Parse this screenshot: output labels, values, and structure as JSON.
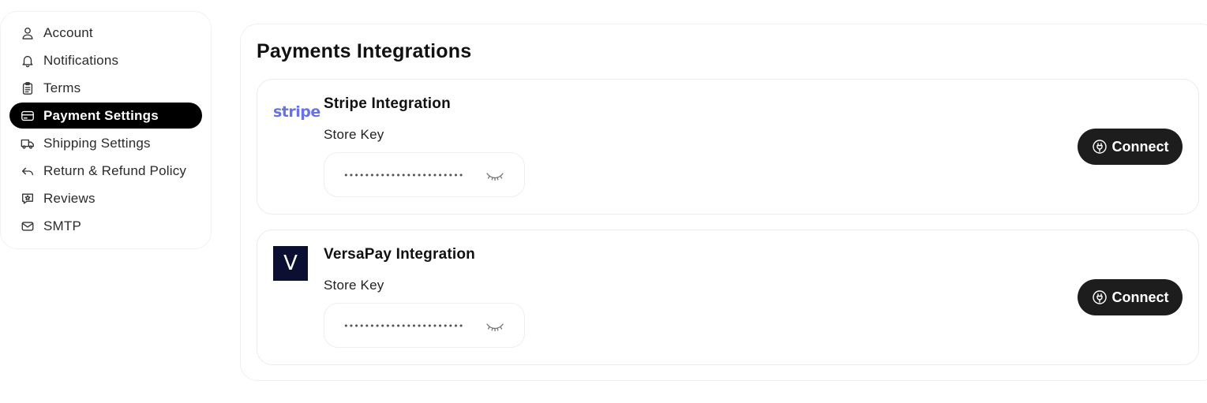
{
  "sidebar": {
    "items": [
      {
        "label": "Account",
        "icon": "user-icon"
      },
      {
        "label": "Notifications",
        "icon": "bell-icon"
      },
      {
        "label": "Terms",
        "icon": "clipboard-icon"
      },
      {
        "label": "Payment Settings",
        "icon": "credit-card-icon",
        "active": true
      },
      {
        "label": "Shipping Settings",
        "icon": "truck-icon"
      },
      {
        "label": "Return & Refund Policy",
        "icon": "return-arrow-icon"
      },
      {
        "label": "Reviews",
        "icon": "star-message-icon"
      },
      {
        "label": "SMTP",
        "icon": "mail-icon"
      }
    ]
  },
  "main": {
    "title": "Payments Integrations",
    "integrations": [
      {
        "logo_text": "stripe",
        "logo_color": "#6772e5",
        "title": "Stripe Integration",
        "field_label": "Store Key",
        "key_value": "•••••••••••••••••••••••",
        "connect_label": "Connect"
      },
      {
        "logo_text": "V",
        "logo_color": "#0b1033",
        "title": "VersaPay Integration",
        "field_label": "Store Key",
        "key_value": "•••••••••••••••••••••••",
        "connect_label": "Connect"
      }
    ]
  },
  "colors": {
    "active_nav_bg": "#000000",
    "button_bg": "#1d1d1d",
    "stripe_brand": "#6772e5"
  }
}
